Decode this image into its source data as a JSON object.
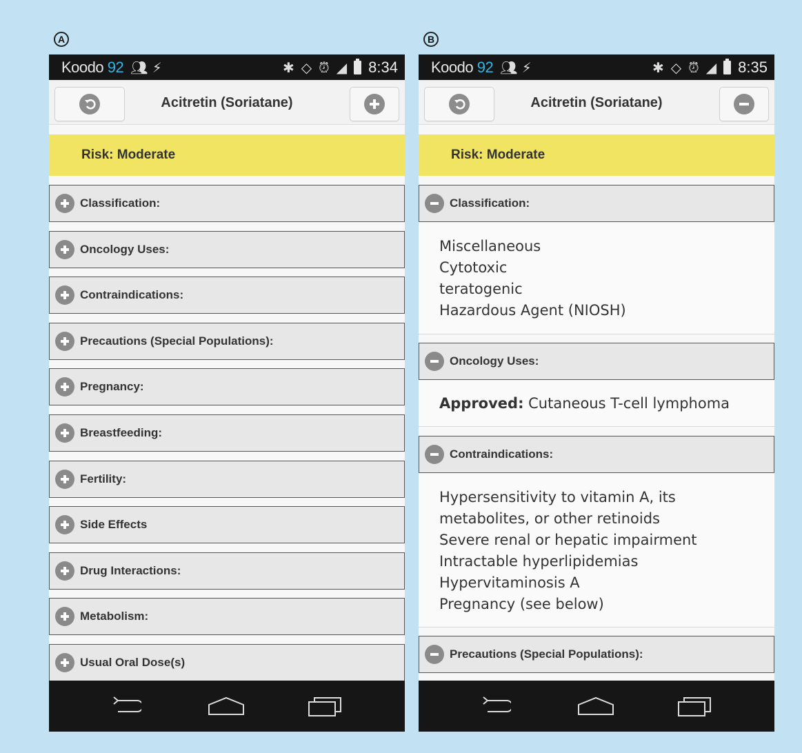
{
  "panels": [
    {
      "letter": "A",
      "status": {
        "carrier": "Koodo",
        "carrier_num": "92",
        "time": "8:34"
      },
      "toolbar": {
        "title": "Acitretin (Soriatane)",
        "back_icon": "back-arrow-icon",
        "toggle_icon": "plus-icon"
      },
      "risk": "Risk: Moderate",
      "sections": [
        "Classification:",
        "Oncology Uses:",
        "Contraindications:",
        "Precautions (Special Populations):",
        "Pregnancy:",
        "Breastfeeding:",
        "Fertility:",
        "Side Effects",
        "Drug Interactions:",
        "Metabolism:",
        "Usual Oral Dose(s)"
      ]
    },
    {
      "letter": "B",
      "status": {
        "carrier": "Koodo",
        "carrier_num": "92",
        "time": "8:35"
      },
      "toolbar": {
        "title": "Acitretin (Soriatane)",
        "back_icon": "back-arrow-icon",
        "toggle_icon": "minus-icon"
      },
      "risk": "Risk: Moderate",
      "sections": [
        {
          "label": "Classification:",
          "lines": [
            "Miscellaneous",
            "Cytotoxic",
            "teratogenic",
            "Hazardous Agent (NIOSH)"
          ]
        },
        {
          "label": "Oncology Uses:",
          "bold_prefix": "Approved:",
          "text": " Cutaneous T-cell lymphoma"
        },
        {
          "label": "Contraindications:",
          "lines": [
            "Hypersensitivity to vitamin A, its",
            "metabolites, or other retinoids",
            "Severe renal or hepatic impairment",
            "Intractable hyperlipidemias",
            "Hypervitaminosis A",
            "Pregnancy (see below)"
          ]
        },
        {
          "label": "Precautions (Special Populations):"
        }
      ]
    }
  ],
  "colors": {
    "background": "#c2e2f3",
    "risk": "#f0e462",
    "statusbar": "#161616",
    "carrier_num": "#33b5e5",
    "icon": "#8a8a8a"
  }
}
